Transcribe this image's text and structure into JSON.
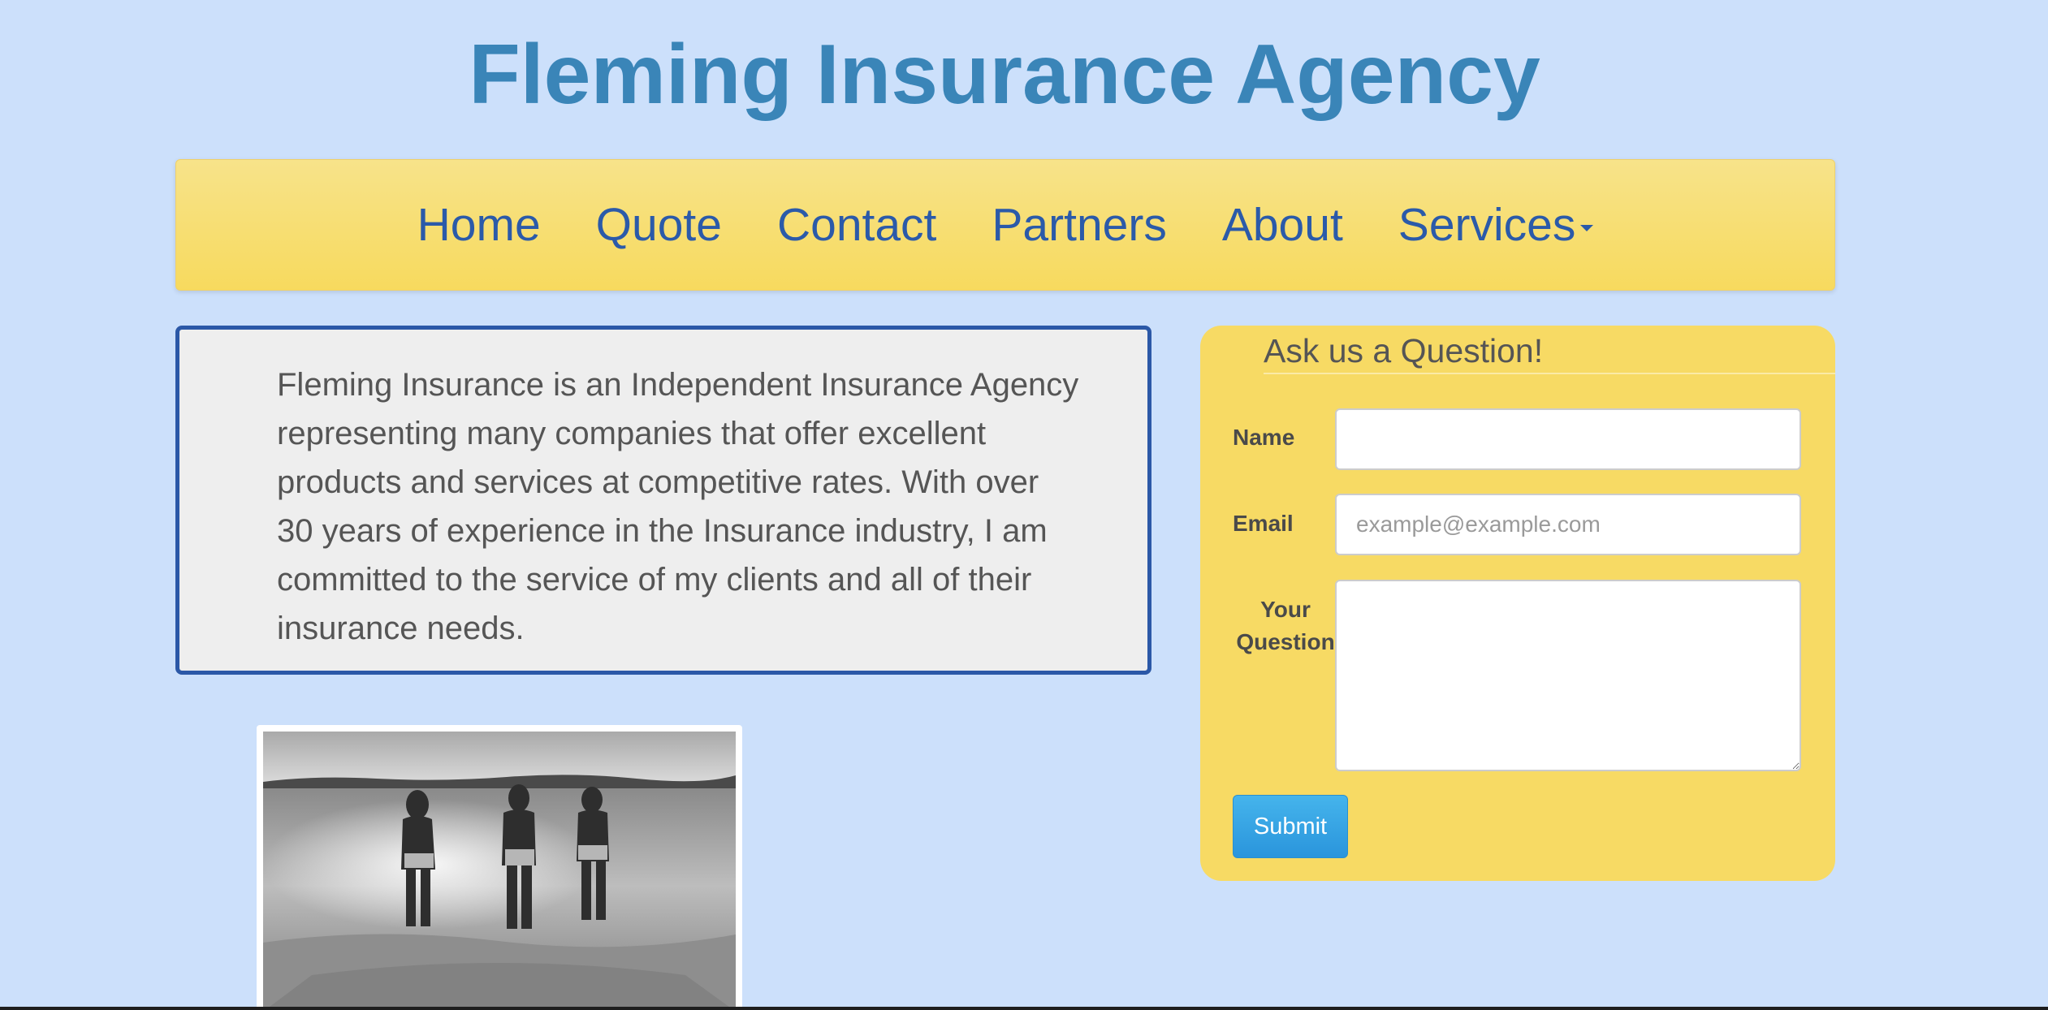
{
  "header": {
    "title": "Fleming Insurance Agency"
  },
  "nav": {
    "items": [
      {
        "label": "Home"
      },
      {
        "label": "Quote"
      },
      {
        "label": "Contact"
      },
      {
        "label": "Partners"
      },
      {
        "label": "About"
      },
      {
        "label": "Services"
      }
    ]
  },
  "about": {
    "text": "Fleming Insurance is an Independent Insurance Agency representing many companies that offer excellent products and services at competitive rates. With over 30 years of experience in the Insurance industry, I am committed to the service of my clients and all of their insurance needs."
  },
  "form": {
    "title": "Ask us a Question!",
    "name_label": "Name",
    "name_value": "",
    "email_label": "Email",
    "email_placeholder": "example@example.com",
    "email_value": "",
    "question_label": "Your Question",
    "question_value": "",
    "submit_label": "Submit"
  },
  "colors": {
    "background": "#cce0fb",
    "title": "#3a85b8",
    "nav_link": "#2b5aa9",
    "nav_bar": "#f7da5e",
    "panel": "#f7da64",
    "about_border": "#2b58a7",
    "submit": "#2a95dc"
  },
  "icons": {
    "services_dropdown": "caret-down-icon"
  }
}
